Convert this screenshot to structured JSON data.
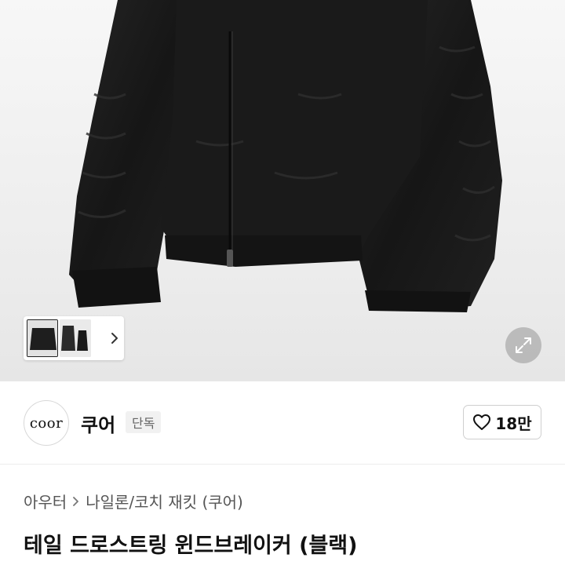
{
  "product_image": {
    "thumbnails": [
      "thumbnail-1",
      "thumbnail-2"
    ],
    "thumbnail_next_icon": "chevron-right-icon",
    "expand_icon": "expand-icon"
  },
  "seller": {
    "avatar_text": "coor",
    "name": "쿠어",
    "badge": "단독"
  },
  "like": {
    "icon": "heart-outline-icon",
    "count": "18만"
  },
  "breadcrumb": {
    "category": "아우터",
    "subcategory": "나일론/코치 재킷 (쿠어)"
  },
  "product": {
    "title": "테일 드로스트링 윈드브레이커 (블랙)"
  },
  "colors": {
    "jacket": "#1b1b1b",
    "background": "#eeeeee",
    "border": "#cfcfcf"
  }
}
